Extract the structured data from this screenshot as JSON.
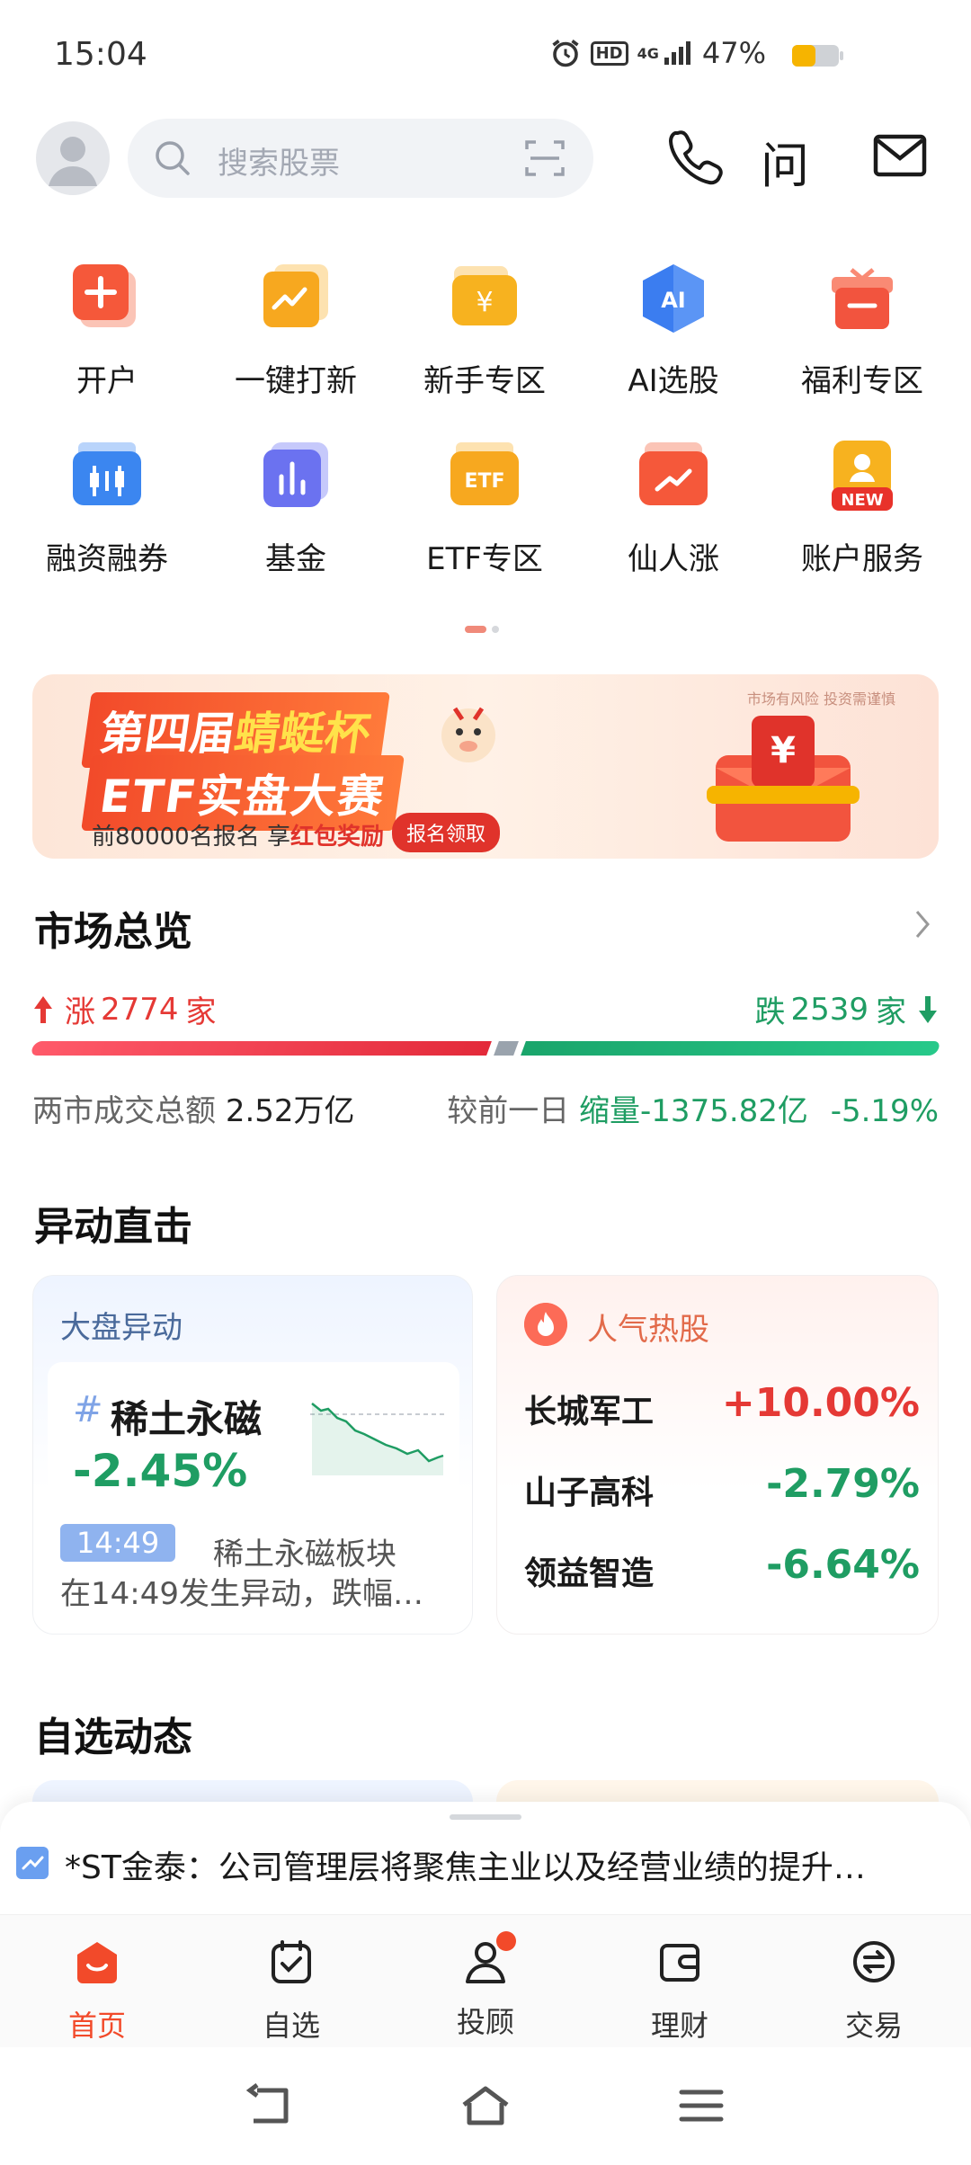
{
  "status": {
    "time": "15:04",
    "battery": "47%",
    "network": "4G",
    "hd": "HD"
  },
  "header": {
    "search_placeholder": "搜索股票",
    "ask_label": "问"
  },
  "quick_grid": [
    {
      "label": "开户",
      "icon": "open-account-icon",
      "color": "#f5583a"
    },
    {
      "label": "一键打新",
      "icon": "new-stock-icon",
      "color": "#f5a623"
    },
    {
      "label": "新手专区",
      "icon": "beginner-icon",
      "color": "#f5b021"
    },
    {
      "label": "AI选股",
      "icon": "ai-icon",
      "color": "#3b7df0"
    },
    {
      "label": "福利专区",
      "icon": "gift-icon",
      "color": "#f2543e"
    },
    {
      "label": "融资融券",
      "icon": "margin-icon",
      "color": "#3b86f0"
    },
    {
      "label": "基金",
      "icon": "fund-icon",
      "color": "#6b72f0"
    },
    {
      "label": "ETF专区",
      "icon": "etf-icon",
      "color": "#f5a623"
    },
    {
      "label": "仙人涨",
      "icon": "rise-icon",
      "color": "#f5583a"
    },
    {
      "label": "账户服务",
      "icon": "account-service-icon",
      "color": "#f5b021"
    }
  ],
  "grid_badges": {
    "ai": "AI",
    "etf": "ETF",
    "new": "NEW",
    "yen": "¥"
  },
  "banner": {
    "title_a": "第四届",
    "title_b": "蜻蜓杯",
    "line2": "ETF实盘大赛",
    "sub_a": "前80000名报名 享",
    "sub_b": "红包奖励",
    "button": "报名领取",
    "note": "市场有风险 投资需谨慎"
  },
  "market": {
    "title": "市场总览",
    "up_label": "涨",
    "up_count": "2774",
    "unit": "家",
    "down_label": "跌",
    "down_count": "2539",
    "turnover_label": "两市成交总额",
    "turnover_value": "2.52万亿",
    "cmp_label": "较前一日",
    "cmp_value": "缩量-1375.82亿",
    "cmp_pct": "-5.19%"
  },
  "movers": {
    "title": "异动直击",
    "left": {
      "title": "大盘异动",
      "hash": "#",
      "name": "稀土永磁",
      "pct": "-2.45%",
      "time": "14:49",
      "desc1": "稀土永磁板块",
      "desc2": "在14:49发生异动，跌幅…"
    },
    "right": {
      "title": "人气热股",
      "rows": [
        {
          "name": "长城军工",
          "pct": "+10.00%"
        },
        {
          "name": "山子高科",
          "pct": "-2.79%"
        },
        {
          "name": "领益智造",
          "pct": "-6.64%"
        }
      ]
    }
  },
  "watchlist": {
    "title": "自选动态"
  },
  "news": {
    "text": "*ST金泰：公司管理层将聚焦主业以及经营业绩的提升…"
  },
  "tabs": [
    {
      "label": "首页",
      "icon": "home-tab-icon"
    },
    {
      "label": "自选",
      "icon": "watchlist-tab-icon"
    },
    {
      "label": "投顾",
      "icon": "advisor-tab-icon"
    },
    {
      "label": "理财",
      "icon": "wallet-tab-icon"
    },
    {
      "label": "交易",
      "icon": "trade-tab-icon"
    }
  ]
}
